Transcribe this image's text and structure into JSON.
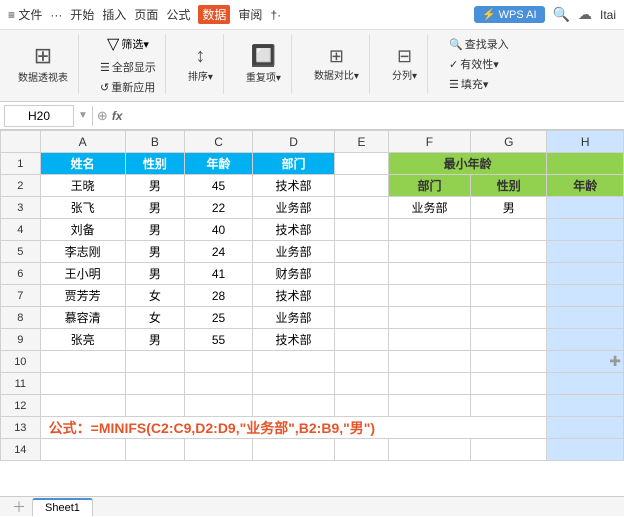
{
  "titlebar": {
    "menus": [
      "≡ 文件",
      "···",
      "开始",
      "插入",
      "页面",
      "公式",
      "数据",
      "审阅",
      "†·"
    ],
    "active_menu": "数据",
    "wps_ai": "WPS AI",
    "search_placeholder": "搜索"
  },
  "ribbon": {
    "btn1_icon": "⊞",
    "btn1_label": "数据透视表",
    "btn2_icon": "▼",
    "btn2_label": "筛选▾",
    "btn3a_label": "全部显示",
    "btn3b_label": "重新应用",
    "btn4_icon": "↕",
    "btn4_label": "排序▾",
    "btn5_icon": "🔲",
    "btn5_label": "重复项▾",
    "btn6_icon": "⊞",
    "btn6_label": "数据对比▾",
    "btn7_icon": "⊟",
    "btn7_label": "分列▾",
    "btn8a_label": "查找录入",
    "btn8b_label": "有效性▾",
    "btn9_icon": "☰",
    "btn9_label": "填充▾"
  },
  "formula_bar": {
    "cell_ref": "H20",
    "formula_content": ""
  },
  "columns": [
    "A",
    "B",
    "C",
    "D",
    "E",
    "F",
    "G",
    "H"
  ],
  "rows": [
    {
      "row": 1,
      "a": "姓名",
      "b": "性别",
      "c": "年龄",
      "d": "部门",
      "e": "",
      "f": "",
      "g": "最小年龄",
      "h": "",
      "a_style": "data-header",
      "b_style": "data-header",
      "c_style": "data-header",
      "d_style": "data-header",
      "f_style": "",
      "g_style": "green-header",
      "h_style": "green-header",
      "g_colspan": true
    },
    {
      "row": 2,
      "a": "王晓",
      "b": "男",
      "c": "45",
      "d": "技术部",
      "e": "",
      "f": "部门",
      "g": "性别",
      "h": "年龄",
      "f_style": "green-header",
      "g_style": "green-header",
      "h_style": "green-header"
    },
    {
      "row": 3,
      "a": "张飞",
      "b": "男",
      "c": "22",
      "d": "业务部",
      "e": "",
      "f": "业务部",
      "g": "男",
      "h": "",
      "f_style": "",
      "g_style": "",
      "h_style": ""
    },
    {
      "row": 4,
      "a": "刘备",
      "b": "男",
      "c": "40",
      "d": "技术部",
      "e": "",
      "f": "",
      "g": "",
      "h": ""
    },
    {
      "row": 5,
      "a": "李志刚",
      "b": "男",
      "c": "24",
      "d": "业务部",
      "e": "",
      "f": "",
      "g": "",
      "h": ""
    },
    {
      "row": 6,
      "a": "王小明",
      "b": "男",
      "c": "41",
      "d": "财务部",
      "e": "",
      "f": "",
      "g": "",
      "h": ""
    },
    {
      "row": 7,
      "a": "贾芳芳",
      "b": "女",
      "c": "28",
      "d": "技术部",
      "e": "",
      "f": "",
      "g": "",
      "h": ""
    },
    {
      "row": 8,
      "a": "慕容清",
      "b": "女",
      "c": "25",
      "d": "业务部",
      "e": "",
      "f": "",
      "g": "",
      "h": ""
    },
    {
      "row": 9,
      "a": "张亮",
      "b": "男",
      "c": "55",
      "d": "技术部",
      "e": "",
      "f": "",
      "g": "",
      "h": ""
    },
    {
      "row": 10,
      "a": "",
      "b": "",
      "c": "",
      "d": "",
      "e": "",
      "f": "",
      "g": "",
      "h": ""
    },
    {
      "row": 11,
      "a": "",
      "b": "",
      "c": "",
      "d": "",
      "e": "",
      "f": "",
      "g": "",
      "h": ""
    },
    {
      "row": 12,
      "a": "",
      "b": "",
      "c": "",
      "d": "",
      "e": "",
      "f": "",
      "g": "",
      "h": ""
    },
    {
      "row": 13,
      "a": "公式：=MINIFS(C2:C9,D2:D9,\"业务部\",B2:B9,\"男\")",
      "b": "",
      "c": "",
      "d": "",
      "e": "",
      "f": "",
      "g": "",
      "h": "",
      "formula_row": true
    },
    {
      "row": 14,
      "a": "",
      "b": "",
      "c": "",
      "d": "",
      "e": "",
      "f": "",
      "g": "",
      "h": ""
    }
  ],
  "sheet_tabs": [
    "Sheet1"
  ],
  "active_tab": "Sheet1",
  "user_name": "Itai"
}
